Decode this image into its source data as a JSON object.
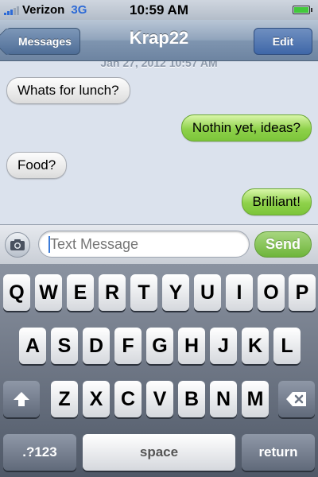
{
  "status_bar": {
    "carrier": "Verizon",
    "network": "3G",
    "time": "10:59 AM",
    "battery_level": 1.0,
    "accent_color": "#2d6ad6"
  },
  "nav_bar": {
    "back_label": "Messages",
    "title": "Krap22",
    "edit_label": "Edit"
  },
  "conversation": {
    "timestamp": "Jan 27, 2012 10:57 AM",
    "messages": [
      {
        "direction": "incoming",
        "text": "Whats for lunch?"
      },
      {
        "direction": "outgoing",
        "text": "Nothin yet, ideas?"
      },
      {
        "direction": "incoming",
        "text": "Food?"
      },
      {
        "direction": "outgoing",
        "text": "Brilliant!"
      }
    ]
  },
  "input_bar": {
    "camera_icon": "camera-icon",
    "placeholder": "Text Message",
    "send_label": "Send"
  },
  "keyboard": {
    "row1": [
      "Q",
      "W",
      "E",
      "R",
      "T",
      "Y",
      "U",
      "I",
      "O",
      "P"
    ],
    "row2": [
      "A",
      "S",
      "D",
      "F",
      "G",
      "H",
      "J",
      "K",
      "L"
    ],
    "row3": [
      "Z",
      "X",
      "C",
      "V",
      "B",
      "N",
      "M"
    ],
    "shift_icon": "shift-icon",
    "delete_icon": "delete-icon",
    "numbers_label": ".?123",
    "space_label": "space",
    "return_label": "return"
  },
  "colors": {
    "outgoing_bubble": "#8ed14a",
    "incoming_bubble": "#f0f0f0",
    "nav_blue": "#6d84a1"
  }
}
